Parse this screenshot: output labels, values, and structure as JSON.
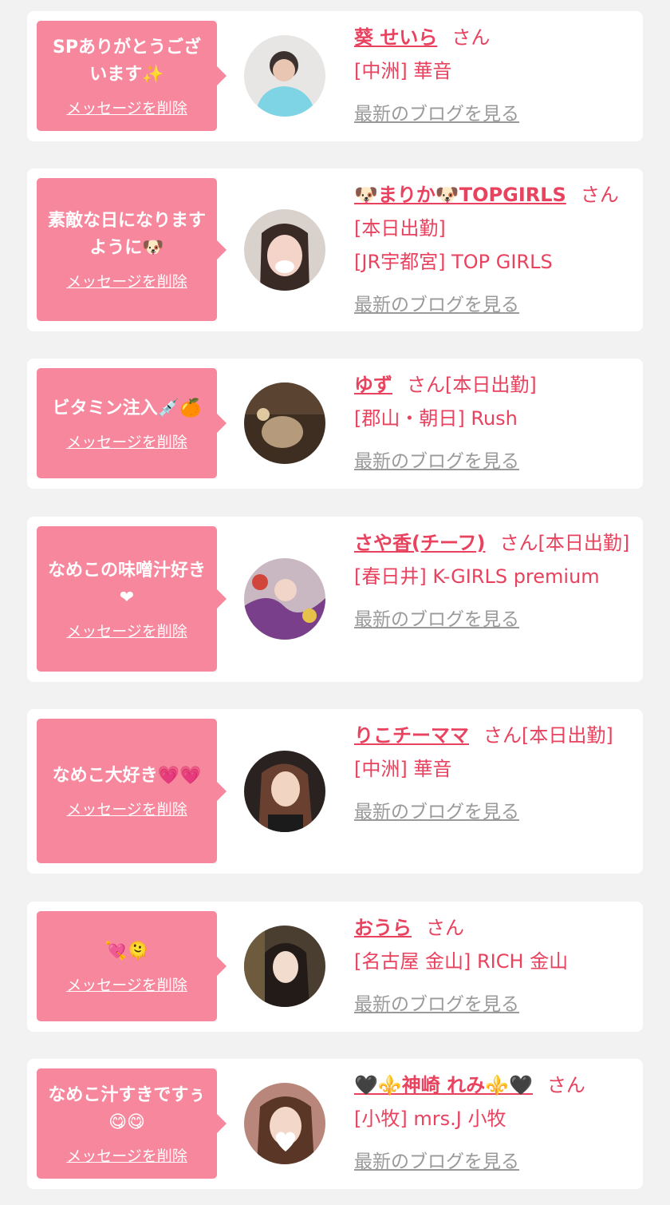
{
  "colors": {
    "bubble": "#f7879d",
    "accent": "#e8425f",
    "link_gray": "#9a9a9a",
    "bg": "#f2f2f2"
  },
  "items": [
    {
      "message": "SPありがとうございます✨",
      "delete": "メッセージを削除",
      "name": "葵 せいら",
      "san": "さん",
      "status": "",
      "shop": "[中洲] 華音",
      "blog": "最新のブログを見る"
    },
    {
      "message": "素敵な日になりますように🐶",
      "delete": "メッセージを削除",
      "name": "🐶まりか🐶TOPGIRLS",
      "san": "さん",
      "status": "[本日出勤]",
      "shop": "[JR宇都宮] TOP GIRLS",
      "blog": "最新のブログを見る"
    },
    {
      "message": "ビタミン注入💉🍊",
      "delete": "メッセージを削除",
      "name": "ゆず",
      "san": "さん",
      "status": "[本日出勤]",
      "shop": "[郡山・朝日] Rush",
      "blog": "最新のブログを見る"
    },
    {
      "message": "なめこの味噌汁好き❤",
      "delete": "メッセージを削除",
      "name": "さや香(チーフ)",
      "san": "さん",
      "status": "[本日出勤]",
      "shop": "[春日井] K-GIRLS premium",
      "blog": "最新のブログを見る"
    },
    {
      "message": "なめこ大好き💗💗",
      "delete": "メッセージを削除",
      "name": "りこチーママ",
      "san": "さん",
      "status": "[本日出勤]",
      "shop": "[中洲] 華音",
      "blog": "最新のブログを見る"
    },
    {
      "message": "💘🫠",
      "delete": "メッセージを削除",
      "name": "おうら",
      "san": "さん",
      "status": "",
      "shop": "[名古屋 金山] RICH 金山",
      "blog": "最新のブログを見る"
    },
    {
      "message": "なめこ汁すきですぅ😋😋",
      "delete": "メッセージを削除",
      "name": "🖤⚜️神崎 れみ⚜️🖤",
      "san": "さん",
      "status": "",
      "shop": "[小牧] mrs.J 小牧",
      "blog": "最新のブログを見る"
    }
  ]
}
